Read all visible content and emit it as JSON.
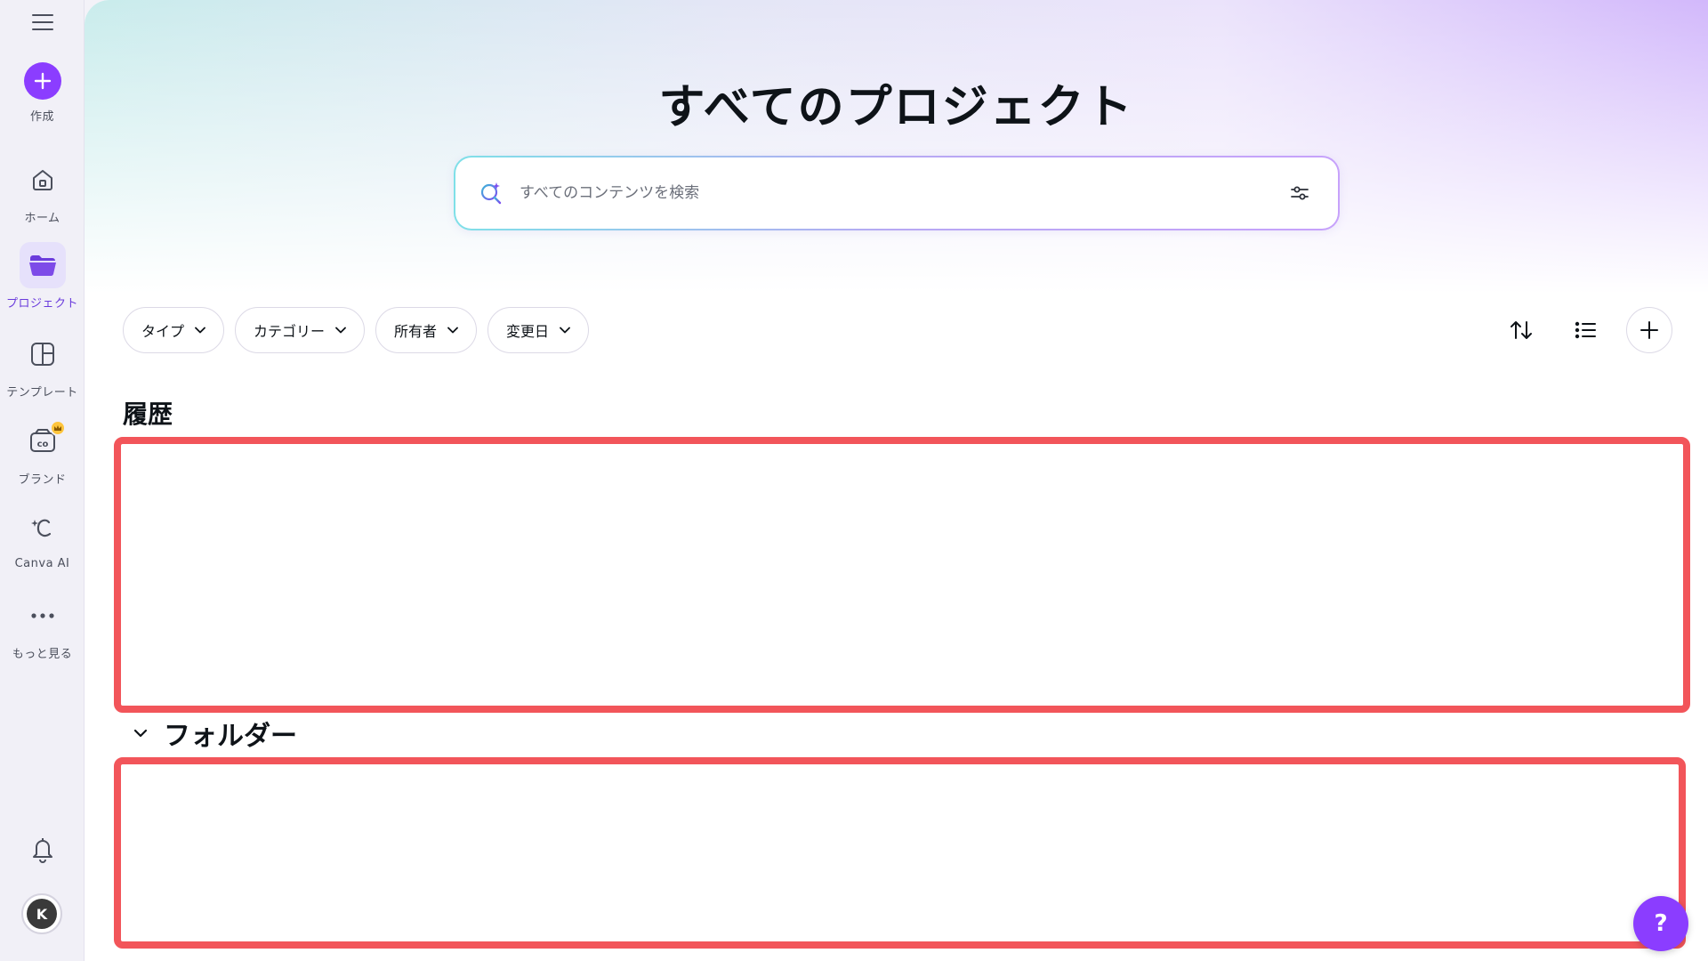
{
  "sidebar": {
    "items": [
      {
        "label": "作成",
        "icon": "plus-icon"
      },
      {
        "label": "ホーム",
        "icon": "home-icon"
      },
      {
        "label": "プロジェクト",
        "icon": "folder-icon"
      },
      {
        "label": "テンプレート",
        "icon": "template-icon"
      },
      {
        "label": "ブランド",
        "icon": "brand-icon"
      },
      {
        "label": "Canva AI",
        "icon": "canva-ai-icon"
      },
      {
        "label": "もっと見る",
        "icon": "more-icon"
      }
    ],
    "active": "プロジェクト",
    "avatar_initial": "K"
  },
  "header": {
    "title": "すべてのプロジェクト"
  },
  "search": {
    "placeholder": "すべてのコンテンツを検索",
    "value": ""
  },
  "filters": [
    {
      "label": "タイプ"
    },
    {
      "label": "カテゴリー"
    },
    {
      "label": "所有者"
    },
    {
      "label": "変更日"
    }
  ],
  "sections": {
    "recent_title": "履歴",
    "folders_title": "フォルダー"
  },
  "help": {
    "label": "?"
  },
  "colors": {
    "accent": "#8b3dff",
    "highlight_border": "#f2555a",
    "crown": "#ffc53d"
  }
}
